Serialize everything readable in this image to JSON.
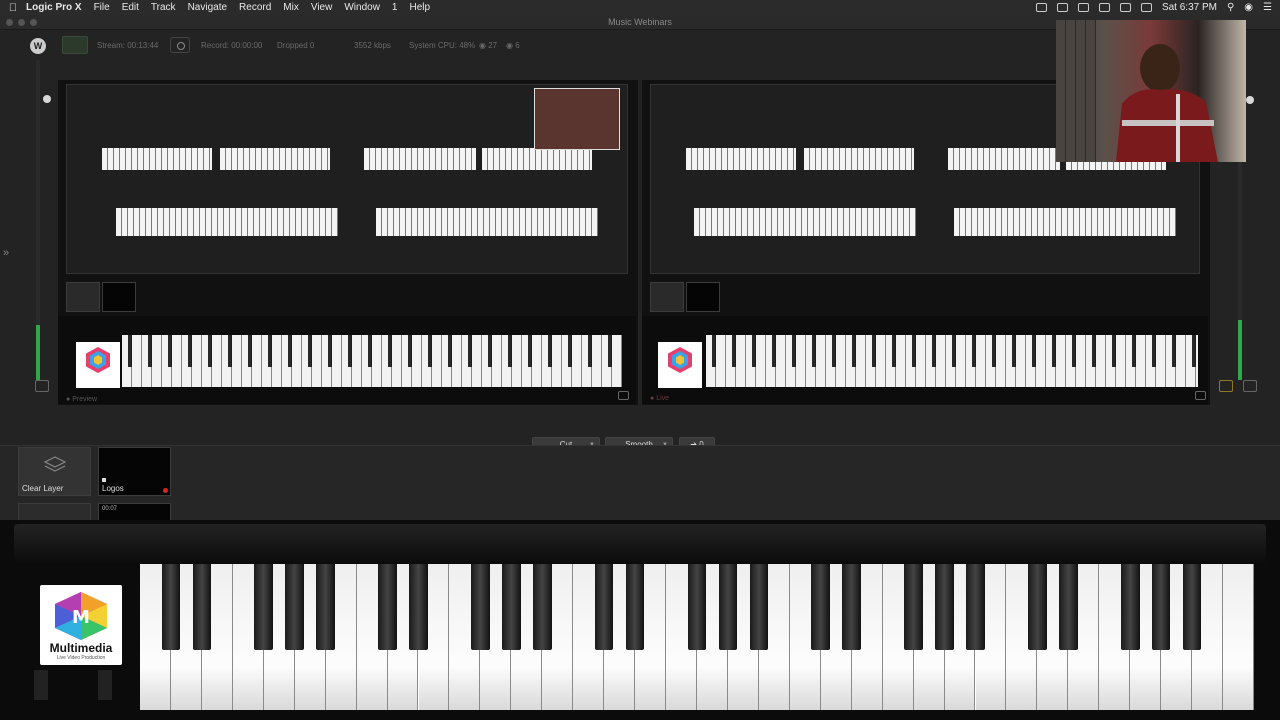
{
  "menubar": {
    "app_name": "Logic Pro X",
    "items": [
      "File",
      "Edit",
      "Track",
      "Navigate",
      "Record",
      "Mix",
      "View",
      "Window",
      "1",
      "Help"
    ],
    "clock": "Sat 6:37 PM"
  },
  "window": {
    "title": "Music Webinars"
  },
  "toolbar": {
    "stream": "Stream: 00:13:44",
    "record": "Record: 00:00:00",
    "dropped": "Dropped 0",
    "bitrate": "3552 kbps",
    "cpu": "System CPU: 48%",
    "count_a": "27",
    "count_b": "6"
  },
  "preview": {
    "label": "Preview"
  },
  "live": {
    "label": "Live"
  },
  "transition": {
    "type": "Cut",
    "mode": "Smooth",
    "go_value": "0"
  },
  "shots": {
    "items": [
      {
        "label": "Clear Layer"
      },
      {
        "label": "Logos"
      }
    ],
    "timer": "00:07"
  },
  "logo": {
    "name": "Multimedia",
    "tagline": "Live Video Production"
  },
  "colors": {
    "meter_green": "#2fa84a",
    "live_red": "#d22222",
    "stream_green": "#2c3a2c"
  }
}
